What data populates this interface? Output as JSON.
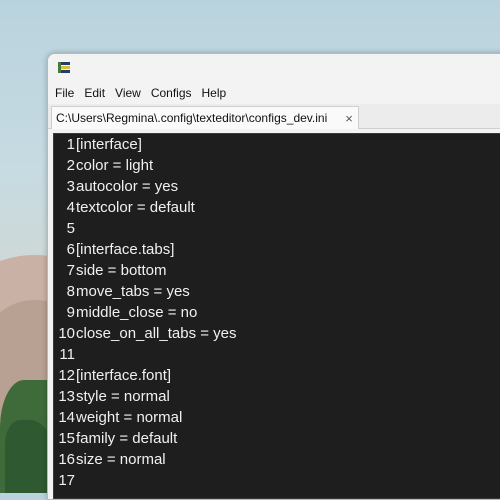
{
  "menu": [
    "File",
    "Edit",
    "View",
    "Configs",
    "Help"
  ],
  "tab": {
    "path": "C:\\Users\\Regmina\\.config\\texteditor\\configs_dev.ini",
    "close_icon": "×"
  },
  "lines": [
    {
      "n": "1",
      "text": "[interface]"
    },
    {
      "n": "2",
      "text": "color = light"
    },
    {
      "n": "3",
      "text": "autocolor = yes"
    },
    {
      "n": "4",
      "text": "textcolor = default"
    },
    {
      "n": "5",
      "text": ""
    },
    {
      "n": "6",
      "text": "[interface.tabs]"
    },
    {
      "n": "7",
      "text": "side = bottom"
    },
    {
      "n": "8",
      "text": "move_tabs = yes"
    },
    {
      "n": "9",
      "text": "middle_close = no"
    },
    {
      "n": "10",
      "text": "close_on_all_tabs = yes"
    },
    {
      "n": "11",
      "text": ""
    },
    {
      "n": "12",
      "text": "[interface.font]"
    },
    {
      "n": "13",
      "text": "style = normal"
    },
    {
      "n": "14",
      "text": "weight = normal"
    },
    {
      "n": "15",
      "text": "family = default"
    },
    {
      "n": "16",
      "text": "size = normal"
    },
    {
      "n": "17",
      "text": ""
    }
  ]
}
